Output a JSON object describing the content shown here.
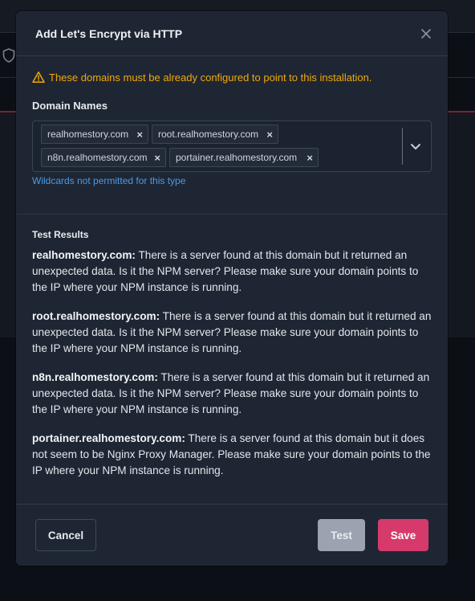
{
  "modal": {
    "title": "Add Let's Encrypt via HTTP",
    "warning": "These domains must be already configured to point to this installation.",
    "field_label": "Domain Names",
    "chips": [
      {
        "label": "realhomestory.com"
      },
      {
        "label": "root.realhomestory.com"
      },
      {
        "label": "n8n.realhomestory.com"
      },
      {
        "label": "portainer.realhomestory.com"
      }
    ],
    "chip_remove_glyph": "×",
    "hint": "Wildcards not permitted for this type",
    "results_title": "Test Results",
    "results": [
      {
        "domain": "realhomestory.com:",
        "message": "There is a server found at this domain but it returned an unexpected data. Is it the NPM server? Please make sure your domain points to the IP where your NPM instance is running."
      },
      {
        "domain": "root.realhomestory.com:",
        "message": "There is a server found at this domain but it returned an unexpected data. Is it the NPM server? Please make sure your domain points to the IP where your NPM instance is running."
      },
      {
        "domain": "n8n.realhomestory.com:",
        "message": "There is a server found at this domain but it returned an unexpected data. Is it the NPM server? Please make sure your domain points to the IP where your NPM instance is running."
      },
      {
        "domain": "portainer.realhomestory.com:",
        "message": "There is a server found at this domain but it does not seem to be Nginx Proxy Manager. Please make sure your domain points to the IP where your NPM instance is running."
      }
    ],
    "buttons": {
      "cancel": "Cancel",
      "test": "Test",
      "save": "Save"
    }
  },
  "colors": {
    "accent": "#d63a6b",
    "warning": "#f1a80a",
    "link": "#4a9be5",
    "modal_bg": "#1f2633"
  },
  "icons": {
    "close": "close-icon",
    "warning": "warning-triangle-icon",
    "dropdown": "chevron-down-icon",
    "background": "shield-icon"
  }
}
